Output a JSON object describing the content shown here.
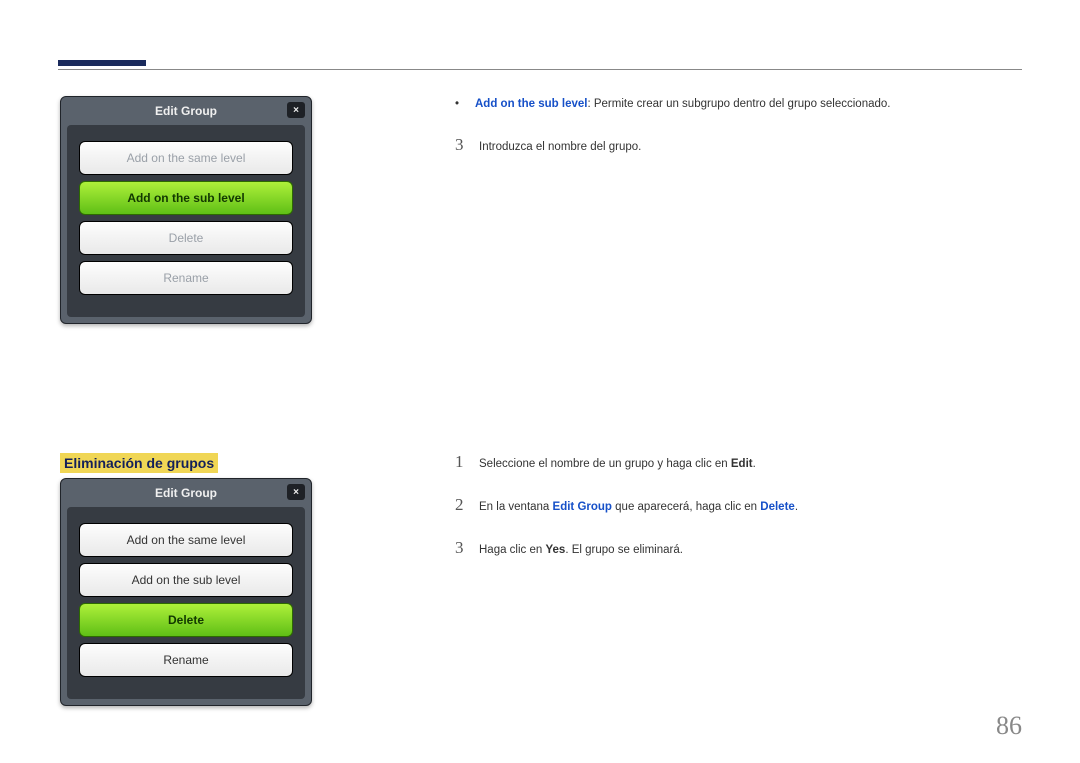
{
  "page_number": "86",
  "section_heading": "Eliminación de grupos",
  "dialog1": {
    "title": "Edit Group",
    "close": "×",
    "buttons": [
      {
        "label": "Add on the same level",
        "state": "faded"
      },
      {
        "label": "Add on the sub level",
        "state": "green"
      },
      {
        "label": "Delete",
        "state": "faded"
      },
      {
        "label": "Rename",
        "state": "faded"
      }
    ]
  },
  "dialog2": {
    "title": "Edit Group",
    "close": "×",
    "buttons": [
      {
        "label": "Add on the same level",
        "state": "white"
      },
      {
        "label": "Add on the sub level",
        "state": "white"
      },
      {
        "label": "Delete",
        "state": "green"
      },
      {
        "label": "Rename",
        "state": "white"
      }
    ]
  },
  "block1": {
    "bullet_lead": "Add on the sub level",
    "bullet_text": ": Permite crear un subgrupo dentro del grupo seleccionado.",
    "step3_num": "3",
    "step3_text": "Introduzca el nombre del grupo."
  },
  "block2": {
    "s1_num": "1",
    "s1_a": "Seleccione el nombre de un grupo y haga clic en ",
    "s1_b": "Edit",
    "s1_c": ".",
    "s2_num": "2",
    "s2_a": "En la ventana ",
    "s2_b": "Edit Group",
    "s2_c": " que aparecerá, haga clic en ",
    "s2_d": "Delete",
    "s2_e": ".",
    "s3_num": "3",
    "s3_a": "Haga clic en ",
    "s3_b": "Yes",
    "s3_c": ". El grupo se eliminará."
  }
}
